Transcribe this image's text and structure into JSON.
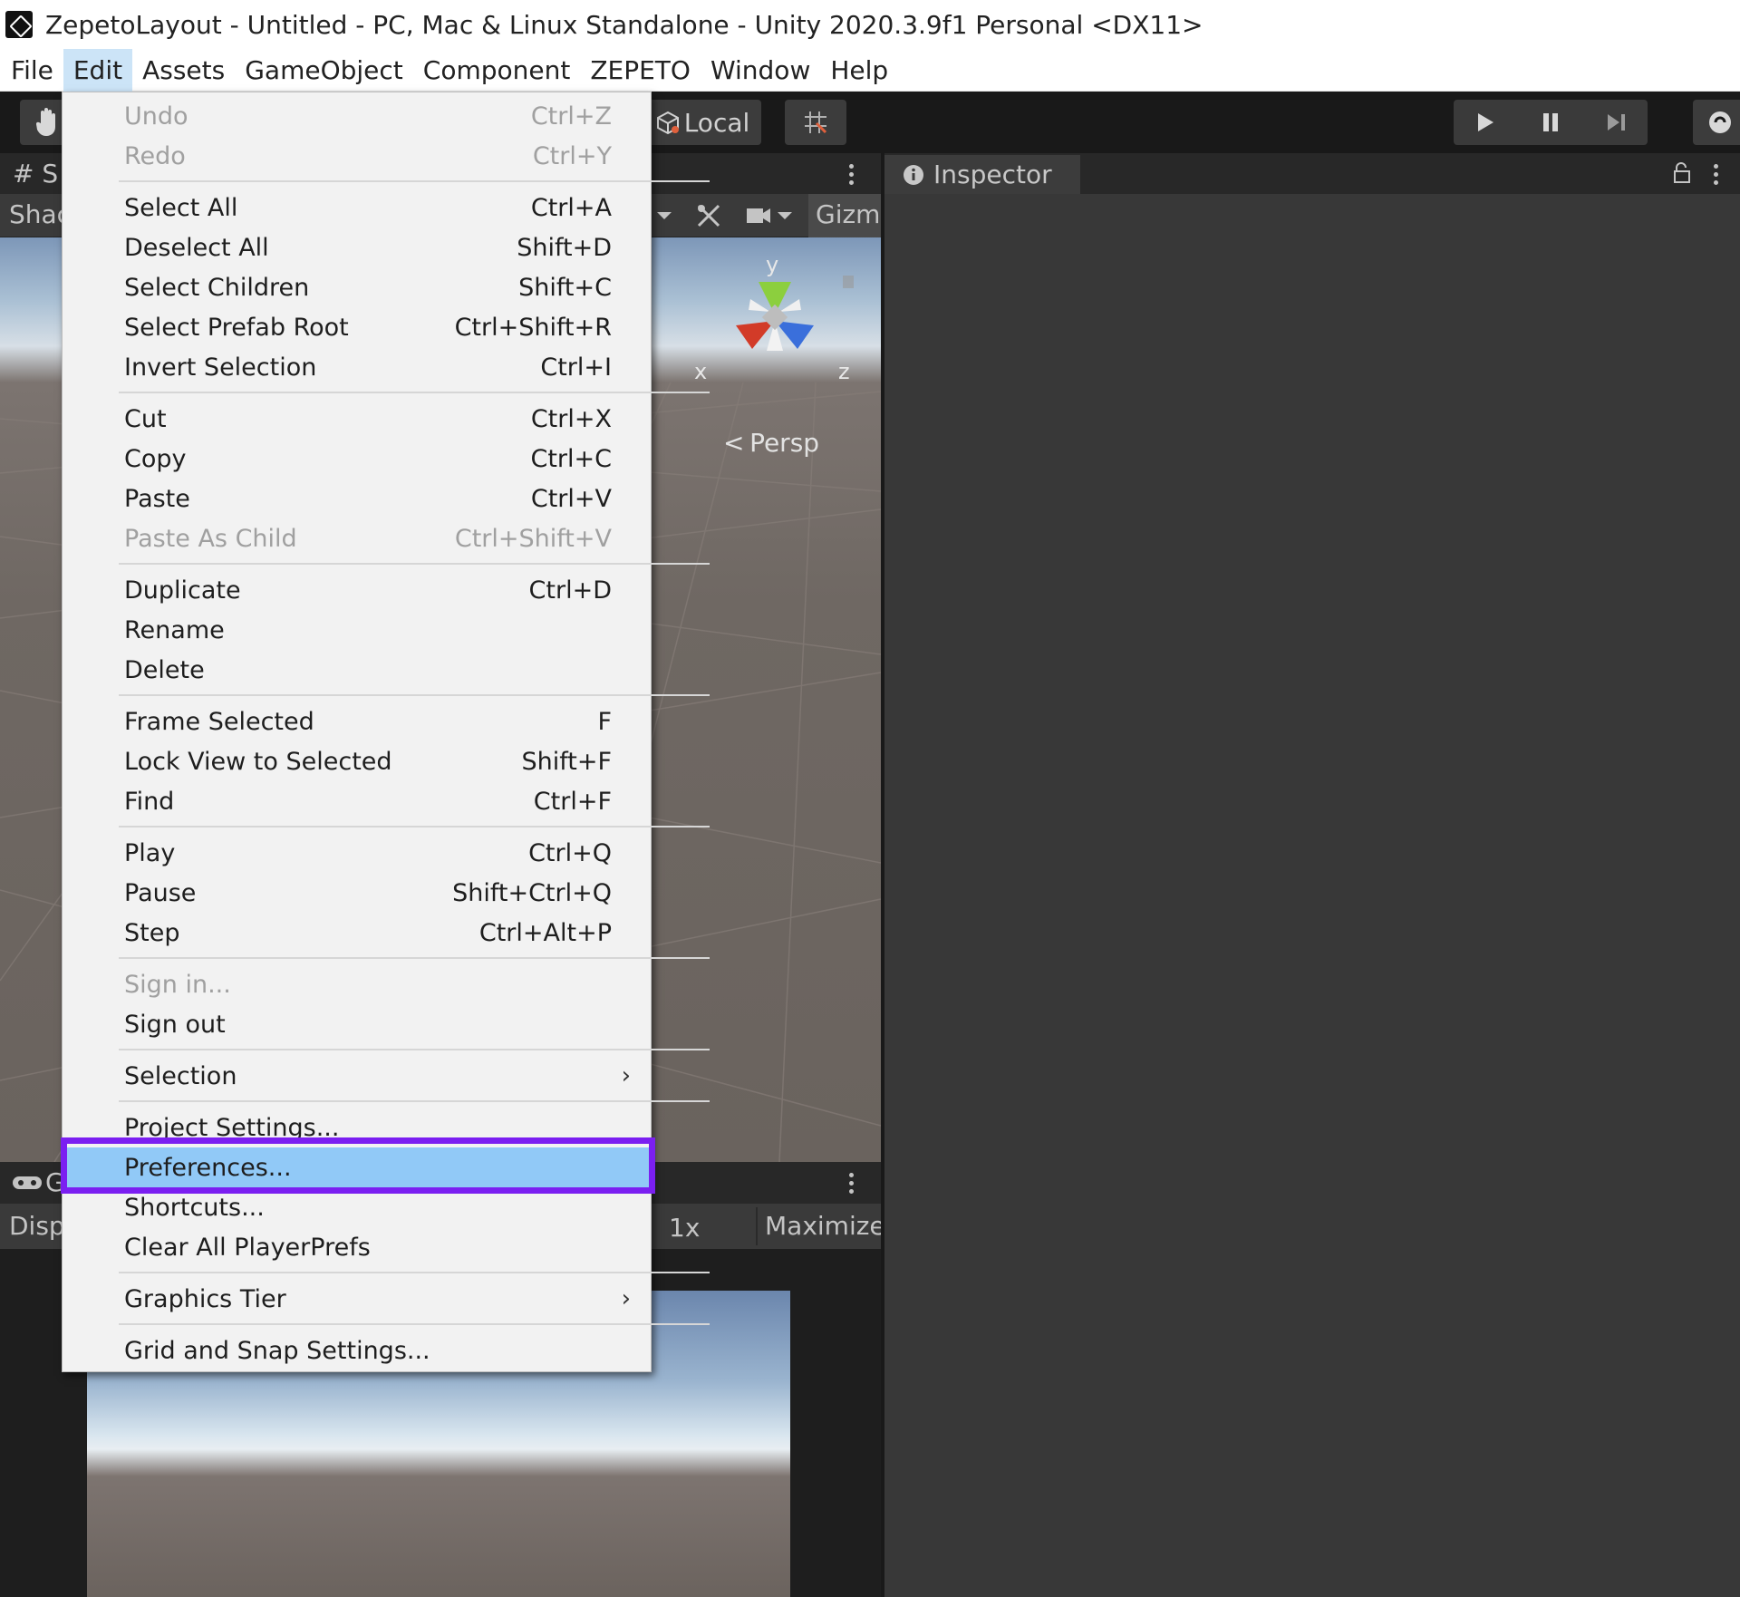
{
  "window": {
    "title": "ZepetoLayout - Untitled - PC, Mac & Linux Standalone - Unity 2020.3.9f1 Personal <DX11>"
  },
  "menubar": [
    "File",
    "Edit",
    "Assets",
    "GameObject",
    "Component",
    "ZEPETO",
    "Window",
    "Help"
  ],
  "toolbar": {
    "pivot_label": "Local"
  },
  "scene": {
    "tab_label": "# S",
    "shading_label": "Shac",
    "gizmos_label": "Gizm",
    "persp_label": "Persp",
    "axis_x": "x",
    "axis_y": "y",
    "axis_z": "z"
  },
  "game": {
    "tab_label": "G",
    "display_label": "Disp",
    "scale_label": "1x",
    "maximize_label": "Maximize"
  },
  "inspector": {
    "tab_label": "Inspector"
  },
  "edit_menu": {
    "items": [
      {
        "label": "Undo",
        "shortcut": "Ctrl+Z"
      },
      {
        "label": "Redo",
        "shortcut": "Ctrl+Y"
      },
      {
        "label": "Select All",
        "shortcut": "Ctrl+A"
      },
      {
        "label": "Deselect All",
        "shortcut": "Shift+D"
      },
      {
        "label": "Select Children",
        "shortcut": "Shift+C"
      },
      {
        "label": "Select Prefab Root",
        "shortcut": "Ctrl+Shift+R"
      },
      {
        "label": "Invert Selection",
        "shortcut": "Ctrl+I"
      },
      {
        "label": "Cut",
        "shortcut": "Ctrl+X"
      },
      {
        "label": "Copy",
        "shortcut": "Ctrl+C"
      },
      {
        "label": "Paste",
        "shortcut": "Ctrl+V"
      },
      {
        "label": "Paste As Child",
        "shortcut": "Ctrl+Shift+V"
      },
      {
        "label": "Duplicate",
        "shortcut": "Ctrl+D"
      },
      {
        "label": "Rename",
        "shortcut": ""
      },
      {
        "label": "Delete",
        "shortcut": ""
      },
      {
        "label": "Frame Selected",
        "shortcut": "F"
      },
      {
        "label": "Lock View to Selected",
        "shortcut": "Shift+F"
      },
      {
        "label": "Find",
        "shortcut": "Ctrl+F"
      },
      {
        "label": "Play",
        "shortcut": "Ctrl+Q"
      },
      {
        "label": "Pause",
        "shortcut": "Shift+Ctrl+Q"
      },
      {
        "label": "Step",
        "shortcut": "Ctrl+Alt+P"
      },
      {
        "label": "Sign in...",
        "shortcut": ""
      },
      {
        "label": "Sign out",
        "shortcut": ""
      },
      {
        "label": "Selection",
        "shortcut": ""
      },
      {
        "label": "Project Settings...",
        "shortcut": ""
      },
      {
        "label": "Preferences...",
        "shortcut": ""
      },
      {
        "label": "Shortcuts...",
        "shortcut": ""
      },
      {
        "label": "Clear All PlayerPrefs",
        "shortcut": ""
      },
      {
        "label": "Graphics Tier",
        "shortcut": ""
      },
      {
        "label": "Grid and Snap Settings...",
        "shortcut": ""
      }
    ]
  },
  "colors": {
    "highlight": "#91c9f7",
    "annotation_box": "#7b1ff1",
    "menu_active": "#cce4f7"
  }
}
